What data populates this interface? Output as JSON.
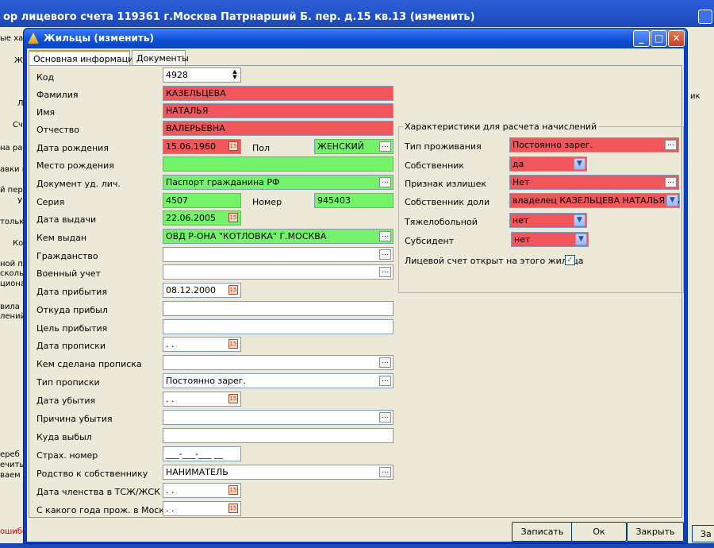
{
  "parent_window": {
    "title": "ор лицевого счета  119361 г.Москва Патрнарший Б. пер. д.15 кв.13 (изменить)",
    "left_fragments": [
      "ые хар",
      "Ж",
      "Л",
      "Сч",
      "на раб",
      "авки к",
      "й пере",
      "У",
      "тольк",
      "Ко",
      "ной п",
      "сколь",
      "циона.",
      "вила р",
      "лений",
      "ереб",
      "ечиты",
      "ваем",
      "ошибо"
    ],
    "right_fragments": [
      "ик",
      "За"
    ]
  },
  "dialog": {
    "title": "Жильцы (изменить)",
    "tabs": [
      "Основная информация",
      "Документы"
    ],
    "fields": {
      "kod_label": "Код",
      "kod_value": "4928",
      "familiya_label": "Фамилия",
      "familiya_value": "КАЗЕЛЬЦЕВА",
      "imya_label": "Имя",
      "imya_value": "НАТАЛЬЯ",
      "otchestvo_label": "Отчество",
      "otchestvo_value": "ВАЛЕРЬЕВНА",
      "dob_label": "Дата рождения",
      "dob_value": "15.06.1960",
      "pol_label": "Пол",
      "pol_value": "ЖЕНСКИЙ",
      "birthplace_label": "Место рождения",
      "birthplace_value": "",
      "doc_label": "Документ уд. лич.",
      "doc_value": "Паспорт гражданина РФ",
      "seriya_label": "Серия",
      "seriya_value": "4507",
      "nomer_label": "Номер",
      "nomer_value": "945403",
      "issue_date_label": "Дата выдачи",
      "issue_date_value": "22.06.2005",
      "issued_by_label": "Кем выдан",
      "issued_by_value": "ОВД  Р-ОНА \"КОТЛОВКА\" Г.МОСКВА",
      "citizenship_label": "Гражданство",
      "citizenship_value": "",
      "military_label": "Военный учет",
      "military_value": "",
      "arrival_date_label": "Дата прибытия",
      "arrival_date_value": "08.12.2000",
      "from_label": "Откуда прибыл",
      "from_value": "",
      "purpose_label": "Цель прибытия",
      "purpose_value": "",
      "reg_date_label": "Дата прописки",
      "reg_date_value": "  .  .",
      "reg_by_label": "Кем сделана прописка",
      "reg_by_value": "",
      "reg_type_label": "Тип прописки",
      "reg_type_value": "Постоянно зарег.",
      "leave_date_label": "Дата убытия",
      "leave_date_value": "  .  .",
      "leave_reason_label": "Причина убытия",
      "leave_reason_value": "",
      "leave_to_label": "Куда выбыл",
      "leave_to_value": "",
      "insurance_label": "Страх. номер",
      "insurance_value": "___-___-___ __",
      "relation_label": "Родство к собственнику",
      "relation_value": "НАНИМАТЕЛЬ",
      "membership_label": "Дата членства в ТСЖ/ЖСК",
      "membership_value": "  .  .",
      "moscow_since_label": "С какого года прож. в Москве",
      "moscow_since_value": "  .  ."
    },
    "charges": {
      "group_title": "Характеристики для расчета начислений",
      "residence_type_label": "Тип проживания",
      "residence_type_value": "Постоянно зарег.",
      "owner_label": "Собственник",
      "owner_value": "да",
      "surplus_label": "Признак излишек",
      "surplus_value": "Нет",
      "share_owner_label": "Собственник доли",
      "share_owner_value": "владелец КАЗЕЛЬЦЕВА НАТАЛЬЯ ВА",
      "ill_label": "Тяжелобольной",
      "ill_value": "нет",
      "subsidy_label": "Субсидент",
      "subsidy_value": "нет",
      "account_opened_label": "Лицевой счет открыт на этого жильца",
      "account_opened_checked": true
    },
    "buttons": {
      "save": "Записать",
      "ok": "Ок",
      "close": "Закрыть"
    }
  },
  "colors": {
    "required": "#f0565a",
    "valid": "#74f36a",
    "titlebar": "#0b4ed4"
  }
}
